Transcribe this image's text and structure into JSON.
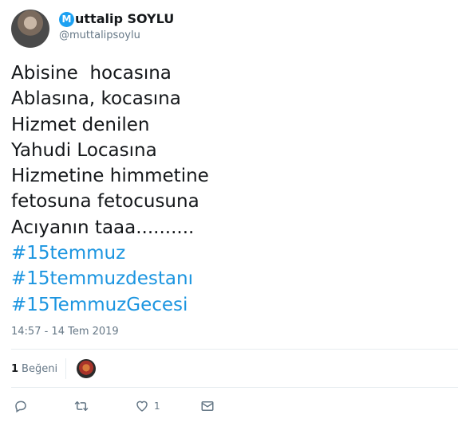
{
  "author": {
    "name_initial": "M",
    "name_rest": "uttalip SOYLU",
    "handle": "@muttalipsoylu"
  },
  "tweet": {
    "lines": [
      {
        "text": "Abisine  hocasına",
        "hashtag": false
      },
      {
        "text": "Ablasına, kocasına",
        "hashtag": false
      },
      {
        "text": "Hizmet denilen",
        "hashtag": false
      },
      {
        "text": "Yahudi Locasına",
        "hashtag": false
      },
      {
        "text": "Hizmetine himmetine",
        "hashtag": false
      },
      {
        "text": "fetosuna fetocusuna",
        "hashtag": false
      },
      {
        "text": "Acıyanın taaa..........",
        "hashtag": false
      },
      {
        "text": "#15temmuz",
        "hashtag": true
      },
      {
        "text": "#15temmuzdestanı",
        "hashtag": true
      },
      {
        "text": "#15TemmuzGecesi",
        "hashtag": true
      }
    ],
    "timestamp": "14:57 - 14 Tem 2019"
  },
  "engagement": {
    "likes_count": "1",
    "likes_label": "Beğeni"
  },
  "actions": {
    "reply_icon": "reply-icon",
    "retweet_icon": "retweet-icon",
    "like_icon": "heart-icon",
    "like_count": "1",
    "dm_icon": "envelope-icon"
  },
  "colors": {
    "hashtag": "#1b95e0",
    "muted": "#657786",
    "text": "#14171a",
    "divider": "#e6ecf0",
    "logo": "#1da1f2"
  }
}
